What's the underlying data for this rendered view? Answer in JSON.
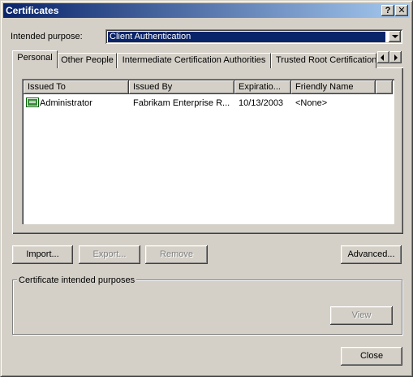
{
  "window": {
    "title": "Certificates",
    "help_glyph": "?",
    "close_glyph": "✕"
  },
  "purpose": {
    "label": "Intended purpose:",
    "value": "Client Authentication"
  },
  "tabs": [
    {
      "label": "Personal"
    },
    {
      "label": "Other People"
    },
    {
      "label": "Intermediate Certification Authorities"
    },
    {
      "label": "Trusted Root Certification Authorities"
    }
  ],
  "list": {
    "columns": [
      "Issued To",
      "Issued By",
      "Expiratio...",
      "Friendly Name"
    ],
    "rows": [
      {
        "issued_to": "Administrator",
        "issued_by": "Fabrikam Enterprise R...",
        "expiration": "10/13/2003",
        "friendly_name": "<None>"
      }
    ]
  },
  "buttons": {
    "import": "Import...",
    "export": "Export...",
    "remove": "Remove",
    "advanced": "Advanced...",
    "view": "View",
    "close": "Close"
  },
  "group": {
    "title": "Certificate intended purposes"
  }
}
